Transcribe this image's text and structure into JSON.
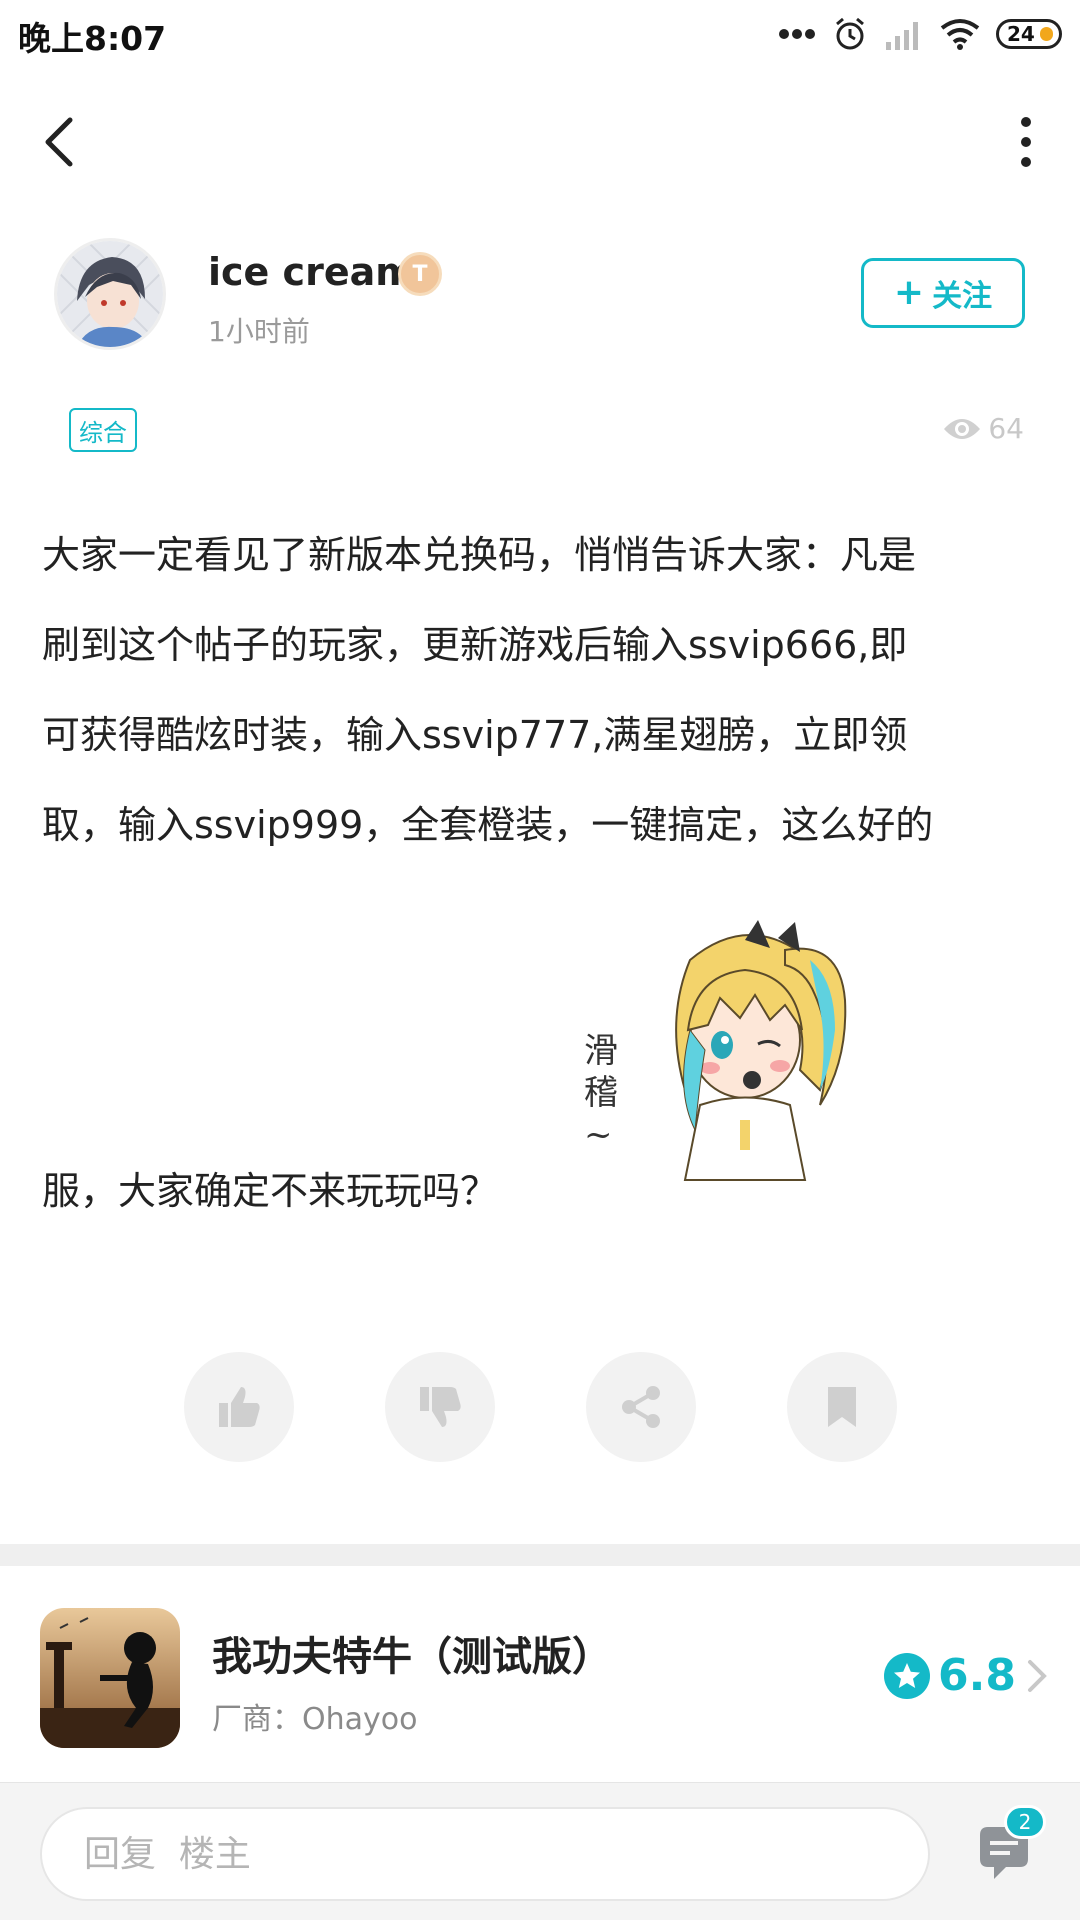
{
  "status_bar": {
    "time": "晚上8:07",
    "battery": "24"
  },
  "author": {
    "name": "ice cream",
    "level_badge": "T",
    "time_ago": "1小时前"
  },
  "follow_button": {
    "icon": "+",
    "label": "关注"
  },
  "category_tag": "综合",
  "view_count": "64",
  "post": {
    "lines": [
      "大家一定看见了新版本兑换码，悄悄告诉大家：凡是",
      "刷到这个帖子的玩家，更新游戏后输入ssvip666,即",
      "可获得酷炫时装，输入ssvip777,满星翅膀，立即领",
      "取，输入ssvip999，全套橙装，一键搞定，这么好的"
    ],
    "last_line": "服，大家确定不来玩玩吗？"
  },
  "sticker": {
    "caption": "滑稽~"
  },
  "actions": {
    "like": "thumbs-up-icon",
    "dislike": "thumbs-down-icon",
    "share": "share-icon",
    "bookmark": "bookmark-icon"
  },
  "game": {
    "title": "我功夫特牛（测试版）",
    "vendor": "厂商：Ohayoo",
    "rating": "6.8"
  },
  "reply": {
    "placeholder": "回复  楼主",
    "comment_count": "2"
  },
  "colors": {
    "accent": "#14b9c8",
    "level_badge": "#f1c59a",
    "battery": "#f2a71b"
  }
}
